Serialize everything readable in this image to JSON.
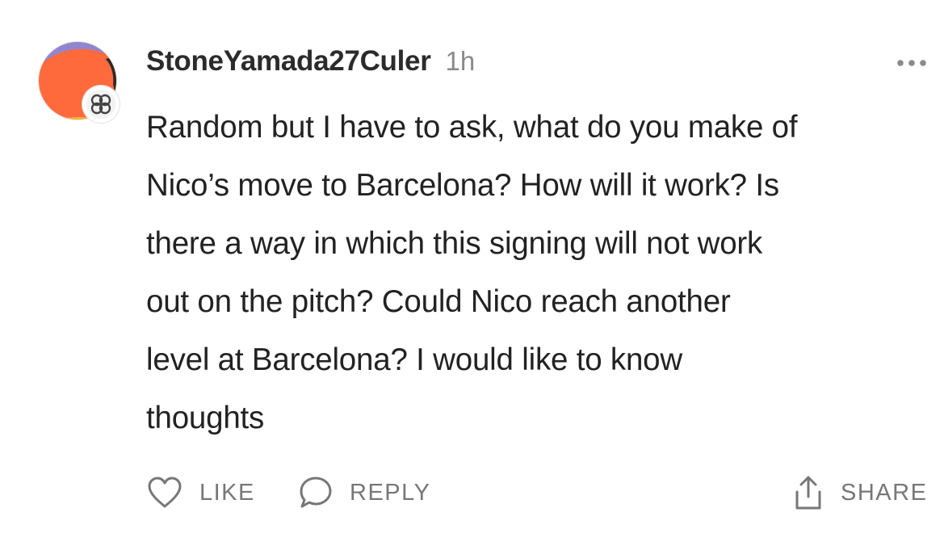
{
  "comment": {
    "author": "StoneYamada27Culer",
    "time": "1h",
    "text": "Random but I have to ask, what do you make of\nNico’s move to Barcelona? How will it work? Is\nthere a way in which this signing will not work\nout on the pitch? Could Nico reach another\nlevel at Barcelona? I would like to know\nthoughts",
    "avatar_colors": {
      "main": "#ff6a3d",
      "purple": "#8f86cf",
      "dark": "#2a2a2a",
      "teal": "#2aa898",
      "yellow": "#f2b53a"
    },
    "badge_icon": "flower-knot-icon",
    "more_icon": "ellipsis-icon"
  },
  "actions": {
    "like": {
      "label": "LIKE",
      "icon": "heart-icon"
    },
    "reply": {
      "label": "REPLY",
      "icon": "speech-bubble-icon"
    },
    "share": {
      "label": "SHARE",
      "icon": "share-arrow-icon"
    }
  },
  "colors": {
    "text": "#222222",
    "muted": "#8a8a8a",
    "action": "#777777"
  }
}
